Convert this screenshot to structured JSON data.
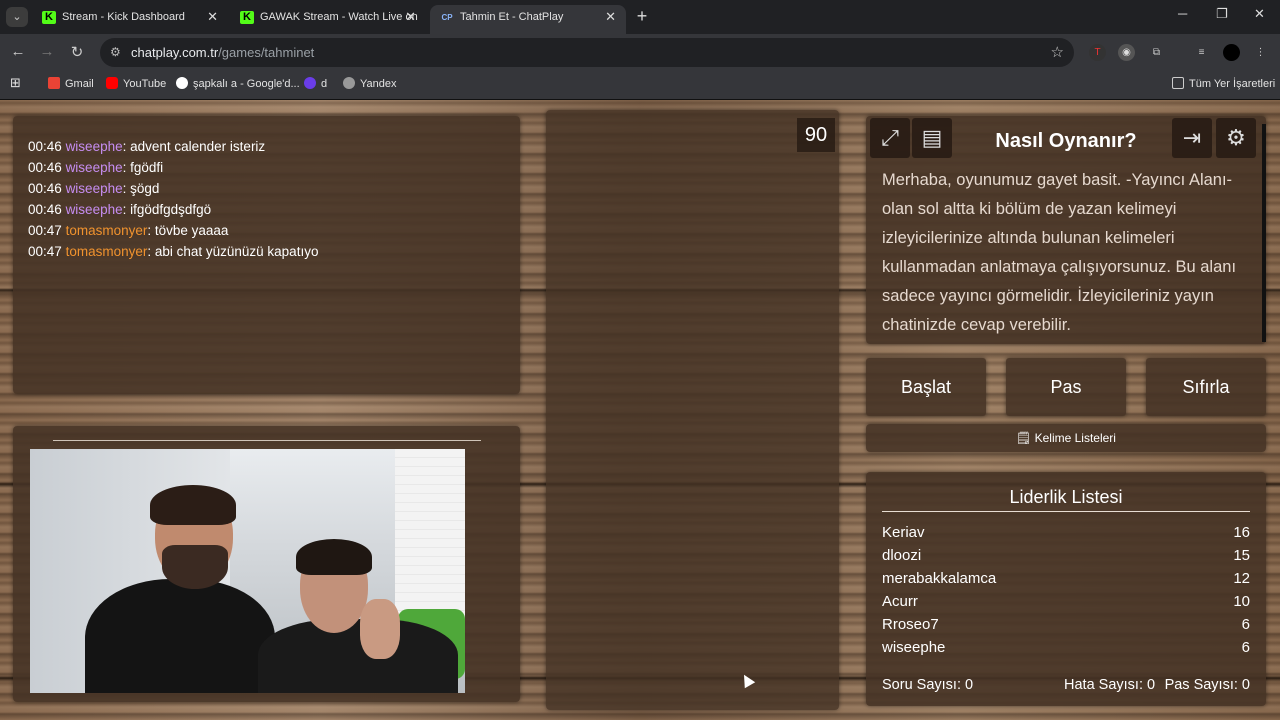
{
  "browser": {
    "tabs": [
      {
        "title": "Stream - Kick Dashboard",
        "icon": "kick-icon"
      },
      {
        "title": "GAWAK Stream - Watch Live on",
        "icon": "kick-icon"
      },
      {
        "title": "Tahmin Et - ChatPlay",
        "icon": "chatplay-icon"
      }
    ],
    "url_host": "chatplay.com.tr",
    "url_path": "/games/tahminet",
    "bookmarks": [
      "Gmail",
      "YouTube",
      "şapkalı a - Google'd...",
      "d",
      "Yandex"
    ],
    "all_bookmarks": "Tüm Yer İşaretleri"
  },
  "chat": {
    "messages": [
      {
        "time": "00:46",
        "user": "wiseephe",
        "text": ": advent calender isteriz"
      },
      {
        "time": "00:46",
        "user": "wiseephe",
        "text": ": fgödfi"
      },
      {
        "time": "00:46",
        "user": "wiseephe",
        "text": ": şögd"
      },
      {
        "time": "00:46",
        "user": "wiseephe",
        "text": ": ifgödfgdşdfgö"
      },
      {
        "time": "00:47",
        "user": "tomasmonyer",
        "text": ": tövbe yaaaa"
      },
      {
        "time": "00:47",
        "user": "tomasmonyer",
        "text": ": abi chat yüzünüzü kapatıyo"
      }
    ],
    "user_colors": {
      "wiseephe": "#c58cf0",
      "tomasmonyer": "#f0922e"
    }
  },
  "timer": "90",
  "how_to": {
    "title": "Nasıl Oynanır?",
    "text": "Merhaba, oyunumuz gayet basit. -Yayıncı Alanı- olan sol altta ki bölüm de yazan kelimeyi izleyicilerinize altında bulunan kelimeleri kullanmadan anlatmaya çalışıyorsunuz. Bu alanı sadece yayıncı görmelidir. İzleyicileriniz yayın chatinizde cevap verebilir."
  },
  "controls": {
    "start": "Başlat",
    "pass": "Pas",
    "reset": "Sıfırla",
    "word_lists": "Kelime Listeleri"
  },
  "leaderboard": {
    "title": "Liderlik Listesi",
    "rows": [
      {
        "name": "Keriav",
        "score": "16"
      },
      {
        "name": "dloozi",
        "score": "15"
      },
      {
        "name": "merabakkalamca",
        "score": "12"
      },
      {
        "name": "Acurr",
        "score": "10"
      },
      {
        "name": "Rroseo7",
        "score": "6"
      },
      {
        "name": "wiseephe",
        "score": "6"
      }
    ]
  },
  "stats": {
    "questions": "Soru Sayısı: 0",
    "errors": "Hata Sayısı: 0",
    "passes": "Pas Sayısı: 0"
  }
}
